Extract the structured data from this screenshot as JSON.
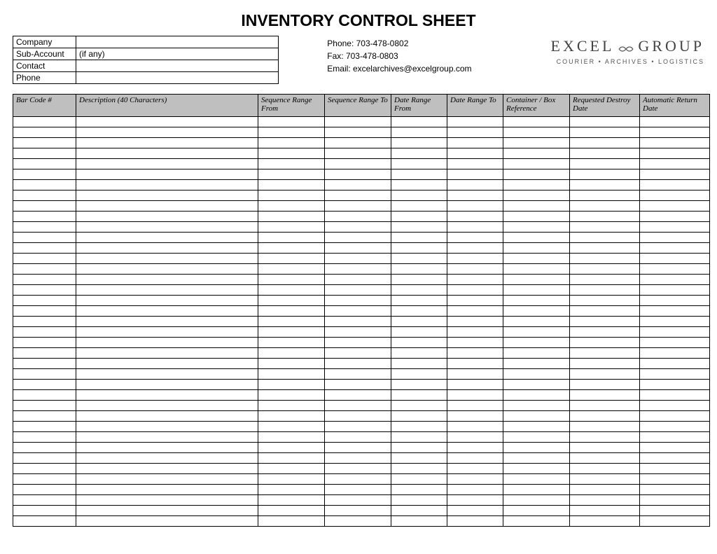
{
  "title": "INVENTORY CONTROL SHEET",
  "info": {
    "company_label": "Company",
    "company_value": "",
    "subaccount_label": "Sub-Account",
    "subaccount_value": "(if any)",
    "contact_label": "Contact",
    "contact_value": "",
    "phone_label": "Phone",
    "phone_value": ""
  },
  "contact": {
    "phone": "Phone: 703-478-0802",
    "fax": "Fax:  703-478-0803",
    "email": "Email: excelarchives@excelgroup.com"
  },
  "logo": {
    "left": "EXCEL",
    "right": "GROUP",
    "tagline": "COURIER • ARCHIVES • LOGISTICS"
  },
  "columns": {
    "barcode": "Bar Code #",
    "description": "Description (40 Characters)",
    "seq_from": "Sequence Range From",
    "seq_to": "Sequence Range To",
    "date_from": "Date Range From",
    "date_to": "Date Range To",
    "container": "Container / Box Reference",
    "destroy": "Requested Destroy Date",
    "return": "Automatic Return Date"
  },
  "row_count": 39
}
